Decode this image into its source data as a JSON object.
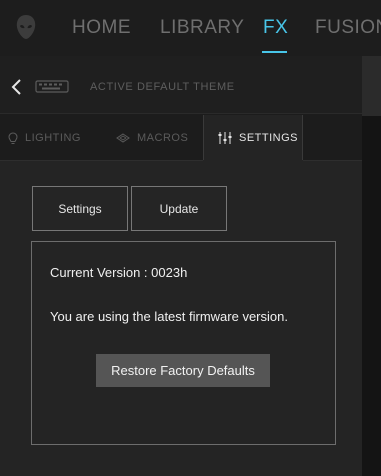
{
  "nav": {
    "items": [
      {
        "label": "HOME"
      },
      {
        "label": "LIBRARY"
      },
      {
        "label": "FX"
      },
      {
        "label": "FUSION"
      }
    ],
    "active": "FX",
    "accent_color": "#48c5e8"
  },
  "theme_bar": {
    "theme_name": "ACTIVE DEFAULT THEME",
    "back_icon": "chevron-left-icon",
    "device_icon": "keyboard-icon"
  },
  "tabs": [
    {
      "label": "LIGHTING",
      "icon": "bulb-icon"
    },
    {
      "label": "MACROS",
      "icon": "macro-icon"
    },
    {
      "label": "SETTINGS",
      "icon": "sliders-icon"
    }
  ],
  "active_tab": "SETTINGS",
  "settings": {
    "subtabs": [
      {
        "label": "Settings"
      },
      {
        "label": "Update"
      }
    ],
    "firmware": {
      "version_text": "Current Version :  0023h",
      "status_text": "You are using the latest firmware version.",
      "restore_label": "Restore Factory Defaults"
    }
  }
}
